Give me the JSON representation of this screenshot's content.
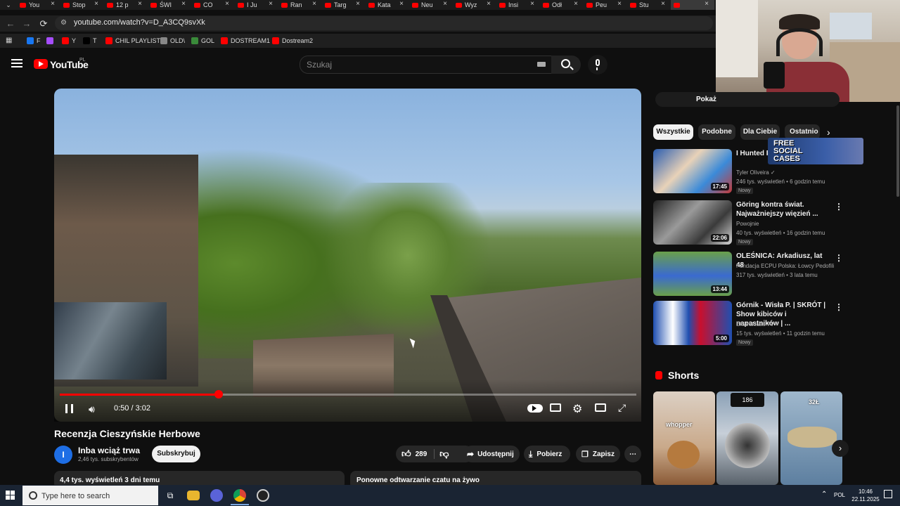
{
  "browser": {
    "tabs": [
      {
        "label": "You",
        "active": false
      },
      {
        "label": "Stop",
        "active": false
      },
      {
        "label": "12 p",
        "active": false
      },
      {
        "label": "ŚWI",
        "active": false
      },
      {
        "label": "CO",
        "active": false
      },
      {
        "label": "I Ju",
        "active": false
      },
      {
        "label": "Ran",
        "active": false
      },
      {
        "label": "Targ",
        "active": false
      },
      {
        "label": "Kata",
        "active": false
      },
      {
        "label": "Neu",
        "active": false
      },
      {
        "label": "Wyz",
        "active": false
      },
      {
        "label": "Insi",
        "active": false
      },
      {
        "label": "Odł",
        "active": false
      },
      {
        "label": "Peu",
        "active": false
      },
      {
        "label": "Stu",
        "active": false
      },
      {
        "label": "",
        "active": true
      }
    ],
    "tab_close_glyph": "×",
    "url": "youtube.com/watch?v=D_A3CQ9svXk",
    "nav": {
      "back": "←",
      "forward": "→",
      "reload": "⟳"
    },
    "bookmarks": [
      {
        "label": "F",
        "color": "#1877f2"
      },
      {
        "label": "Y",
        "color": "#ff0000"
      },
      {
        "label": "",
        "color": "#a64dff"
      },
      {
        "label": "T",
        "color": "#000000"
      },
      {
        "label": "CHIL PLAYLIST",
        "color": "#ff0000"
      },
      {
        "label": "OLD\\",
        "color": "#888888"
      },
      {
        "label": "GOL",
        "color": "#3a8a3a"
      },
      {
        "label": "DOSTREAM1",
        "color": "#ff0000"
      },
      {
        "label": "Dostream2",
        "color": "#ff0000"
      }
    ]
  },
  "youtube": {
    "logo": "YouTube",
    "region": "PL",
    "search_placeholder": "Szukaj"
  },
  "player": {
    "time": "0:50 / 3:02",
    "progress": 0.275
  },
  "video": {
    "title": "Recenzja Cieszyńskie Herbowe",
    "channel_initial": "I",
    "channel_name": "Inba wciąż trwa",
    "channel_subs": "2,46 tys. subskrybentów",
    "subscribe": "Subskrybuj",
    "likes": "289",
    "share": "Udostępnij",
    "download": "Pobierz",
    "save": "Zapisz",
    "more": "⋯",
    "views_date": "4,4 tys. wyświetleń  3 dni temu",
    "chat_replay": "Ponowne odtwarzanie czatu na żywo"
  },
  "sidebar": {
    "overlay_button": "Pokaż",
    "chips": [
      "Wszystkie",
      "Podobne",
      "Dla Ciebie",
      "Ostatnio"
    ],
    "free_social": "FREE SOCIAL CASES",
    "recommendations": [
      {
        "title": "I Hunted Pi... *attacked*",
        "channel": "Tyler Oliveira ✓",
        "meta": "246 tys. wyświetleń • 6 godzin temu",
        "badge": "Nowy",
        "duration": "17:45"
      },
      {
        "title": "Göring kontra świat. Najważniejszy więzień ...",
        "channel": "Powojnie",
        "meta": "40 tys. wyświetleń • 16 godzin temu",
        "badge": "Nowy",
        "duration": "22:06"
      },
      {
        "title": "OLEŚNICA: Arkadiusz, lat 48",
        "channel": "Fundacja ECPU Polska: Łowcy Pedofili",
        "meta": "317 tys. wyświetleń • 3 lata temu",
        "badge": "",
        "duration": "13:44"
      },
      {
        "title": "Górnik - Wisła P. | SKRÓT | Show kibiców i napastników | ...",
        "channel": "Ekstraklasa TV ✓",
        "meta": "15 tys. wyświetleń • 11 godzin temu",
        "badge": "Nowy",
        "duration": "5:00"
      }
    ],
    "more_glyph": "⋮",
    "shorts_title": "Shorts",
    "shorts": [
      {
        "caption": "whopper"
      },
      {
        "caption": "186"
      },
      {
        "caption": "32Ł"
      }
    ]
  },
  "taskbar": {
    "search_placeholder": "Type here to search",
    "lang": "POL",
    "time": "10:46",
    "date": "22.11.2025"
  }
}
